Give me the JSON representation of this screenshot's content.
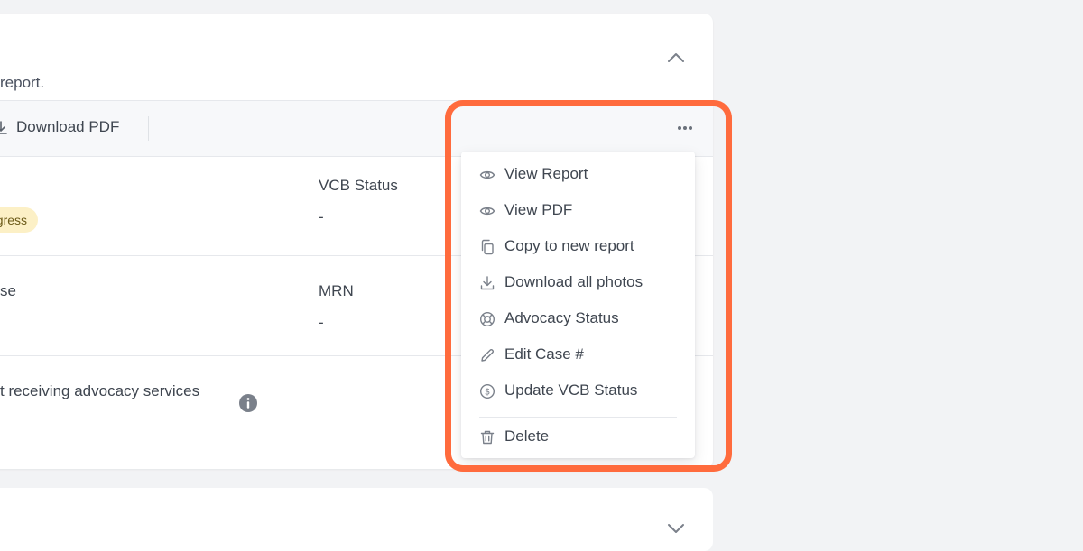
{
  "card": {
    "description": "report.",
    "download_label": "Download PDF",
    "fields": {
      "vcb_status_label": "VCB Status",
      "vcb_status_value": "-",
      "status_badge": "ogress",
      "case_label": "se",
      "mrn_label": "MRN",
      "mrn_value": "-",
      "advocacy_text": "t receiving advocacy services"
    }
  },
  "menu": {
    "items": [
      {
        "label": "View Report",
        "icon": "eye-icon"
      },
      {
        "label": "View PDF",
        "icon": "eye-icon"
      },
      {
        "label": "Copy to new report",
        "icon": "copy-icon"
      },
      {
        "label": "Download all photos",
        "icon": "download-icon"
      },
      {
        "label": "Advocacy Status",
        "icon": "lifebuoy-icon"
      },
      {
        "label": "Edit Case #",
        "icon": "pencil-icon"
      },
      {
        "label": "Update VCB Status",
        "icon": "dollar-circle-icon"
      },
      {
        "label": "Delete",
        "icon": "trash-icon"
      }
    ]
  },
  "colors": {
    "highlight": "#ff6b3d",
    "badge_bg": "#fcf0c6",
    "background": "#f2f3f5"
  }
}
